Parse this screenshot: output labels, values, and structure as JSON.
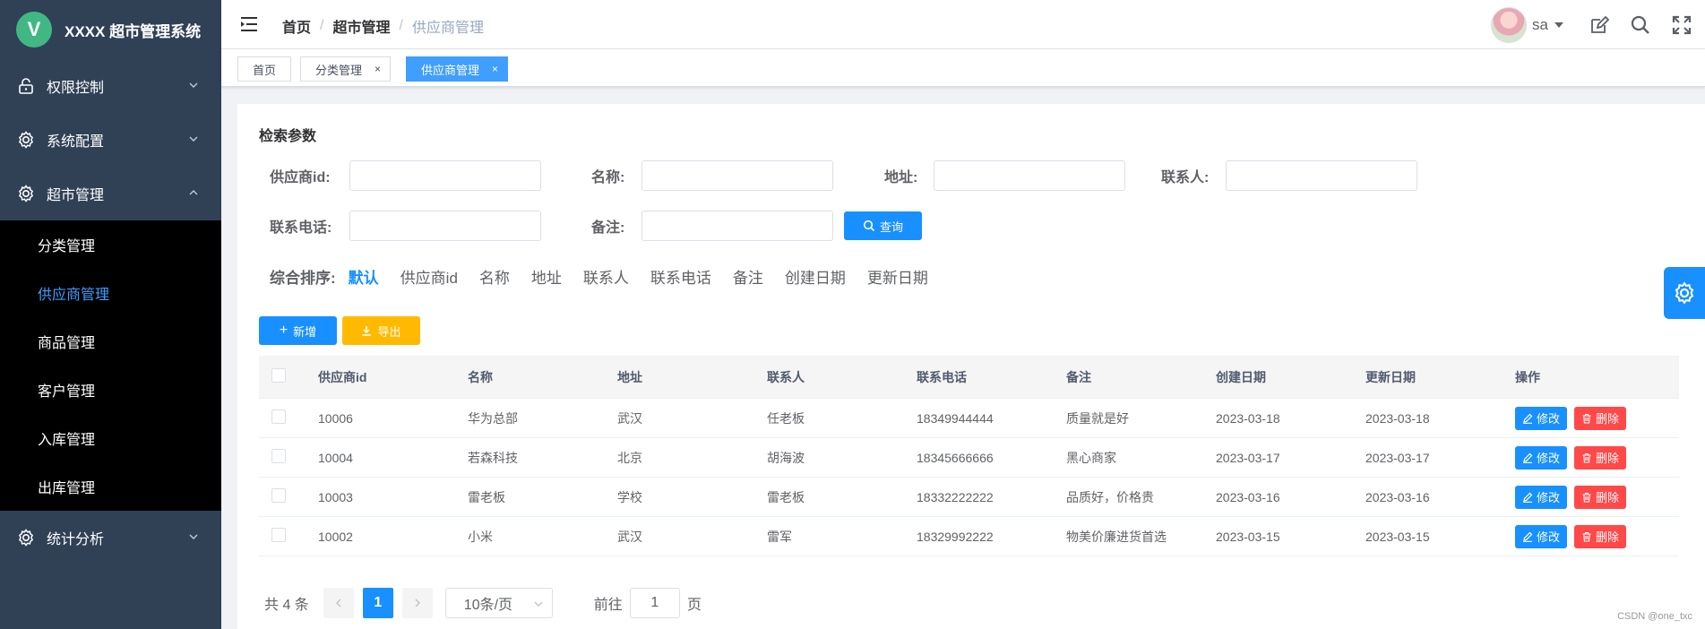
{
  "app": {
    "logo_letter": "V",
    "title": "XXXX 超市管理系统"
  },
  "sidebar": {
    "menus": [
      {
        "label": "权限控制",
        "icon": "lock-icon"
      },
      {
        "label": "系统配置",
        "icon": "gear-icon"
      },
      {
        "label": "超市管理",
        "icon": "gear-icon"
      }
    ],
    "submenu": [
      "分类管理",
      "供应商管理",
      "商品管理",
      "客户管理",
      "入库管理",
      "出库管理"
    ],
    "active_sub": "供应商管理",
    "last_menu": {
      "label": "统计分析",
      "icon": "gear-icon"
    }
  },
  "header": {
    "breadcrumb": [
      "首页",
      "超市管理",
      "供应商管理"
    ],
    "user_name": "sa"
  },
  "tags": [
    {
      "label": "首页",
      "closable": false
    },
    {
      "label": "分类管理",
      "closable": true,
      "close": "×"
    },
    {
      "label": "供应商管理",
      "closable": true,
      "active": true,
      "close": "×"
    }
  ],
  "search": {
    "title": "检索参数",
    "fields": [
      "供应商id:",
      "名称:",
      "地址:",
      "联系人:",
      "联系电话:",
      "备注:"
    ],
    "query_button": "查询"
  },
  "sort": {
    "label": "综合排序:",
    "options": [
      "默认",
      "供应商id",
      "名称",
      "地址",
      "联系人",
      "联系电话",
      "备注",
      "创建日期",
      "更新日期"
    ],
    "active": "默认"
  },
  "toolbar": {
    "add": "新增",
    "export": "导出"
  },
  "table": {
    "headers": [
      "供应商id",
      "名称",
      "地址",
      "联系人",
      "联系电话",
      "备注",
      "创建日期",
      "更新日期",
      "操作"
    ],
    "rows": [
      [
        "10006",
        "华为总部",
        "武汉",
        "任老板",
        "18349944444",
        "质量就是好",
        "2023-03-18",
        "2023-03-18"
      ],
      [
        "10004",
        "若森科技",
        "北京",
        "胡海波",
        "18345666666",
        "黑心商家",
        "2023-03-17",
        "2023-03-17"
      ],
      [
        "10003",
        "雷老板",
        "学校",
        "雷老板",
        "18332222222",
        "品质好，价格贵",
        "2023-03-16",
        "2023-03-16"
      ],
      [
        "10002",
        "小米",
        "武汉",
        "雷军",
        "18329992222",
        "物美价廉进货首选",
        "2023-03-15",
        "2023-03-15"
      ]
    ],
    "edit_label": "修改",
    "delete_label": "删除"
  },
  "pagination": {
    "total_text": "共 4 条",
    "current_page": "1",
    "page_size": "10条/页",
    "goto_prefix": "前往",
    "goto_value": "1",
    "goto_suffix": "页"
  },
  "watermark": "CSDN @one_txc",
  "colors": {
    "primary": "#1890ff",
    "warning": "#ffba00",
    "danger": "#ff4949",
    "sidebar": "#304156"
  }
}
